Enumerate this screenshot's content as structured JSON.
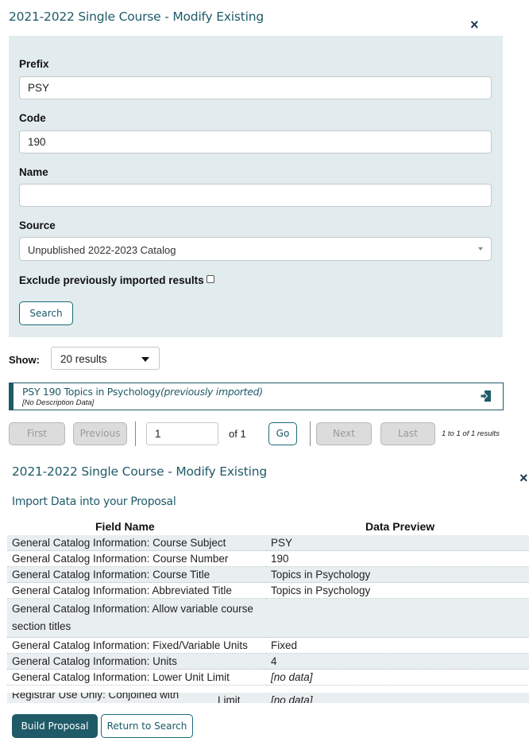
{
  "modal1": {
    "title": "2021-2022 Single Course - Modify Existing",
    "close_symbol": "×",
    "prefix_label": "Prefix",
    "prefix_value": "PSY",
    "code_label": "Code",
    "code_value": "190",
    "name_label": "Name",
    "name_value": "",
    "source_label": "Source",
    "source_selected": "Unpublished 2022-2023 Catalog",
    "exclude_label": "Exclude previously imported results",
    "search_button": "Search"
  },
  "results": {
    "show_label": "Show:",
    "show_selected": "20 results",
    "items": [
      {
        "title": "PSY 190 Topics in Psychology",
        "tag": "(previously imported)",
        "description": "[No Description Data]",
        "import_icon": "import-icon"
      }
    ]
  },
  "pagination": {
    "first": "First",
    "previous": "Previous",
    "page_value": "1",
    "of_text": "of 1",
    "go": "Go",
    "next": "Next",
    "last": "Last",
    "summary": "1 to 1 of 1 results"
  },
  "modal2": {
    "title": "2021-2022 Single Course - Modify Existing",
    "close_symbol": "×",
    "section_title": "Import Data into your Proposal",
    "columns": [
      "Field Name",
      "Data Preview"
    ],
    "rows": [
      [
        "General Catalog Information: Course Subject",
        "PSY"
      ],
      [
        "General Catalog Information: Course Number",
        "190"
      ],
      [
        "General Catalog Information: Course Title",
        "Topics in Psychology"
      ],
      [
        "General Catalog Information: Abbreviated Title",
        "Topics in Psychology"
      ],
      [
        "General Catalog Information: Allow variable course section titles",
        ""
      ],
      [
        "General Catalog Information: Fixed/Variable Units",
        "Fixed"
      ],
      [
        "General Catalog Information: Units",
        "4"
      ],
      [
        "General Catalog Information: Lower Unit Limit",
        "[no data]"
      ]
    ],
    "overlap_text_a": "Registrar Use Only: Conjoined with",
    "overlap_text_b": "Limit",
    "overlap_value": "[no data]",
    "build_button": "Build Proposal",
    "return_button": "Return to Search"
  },
  "colors": {
    "brand": "#1f5a68",
    "panel_bg": "#e2ecee",
    "row_alt": "#e9eef0"
  }
}
